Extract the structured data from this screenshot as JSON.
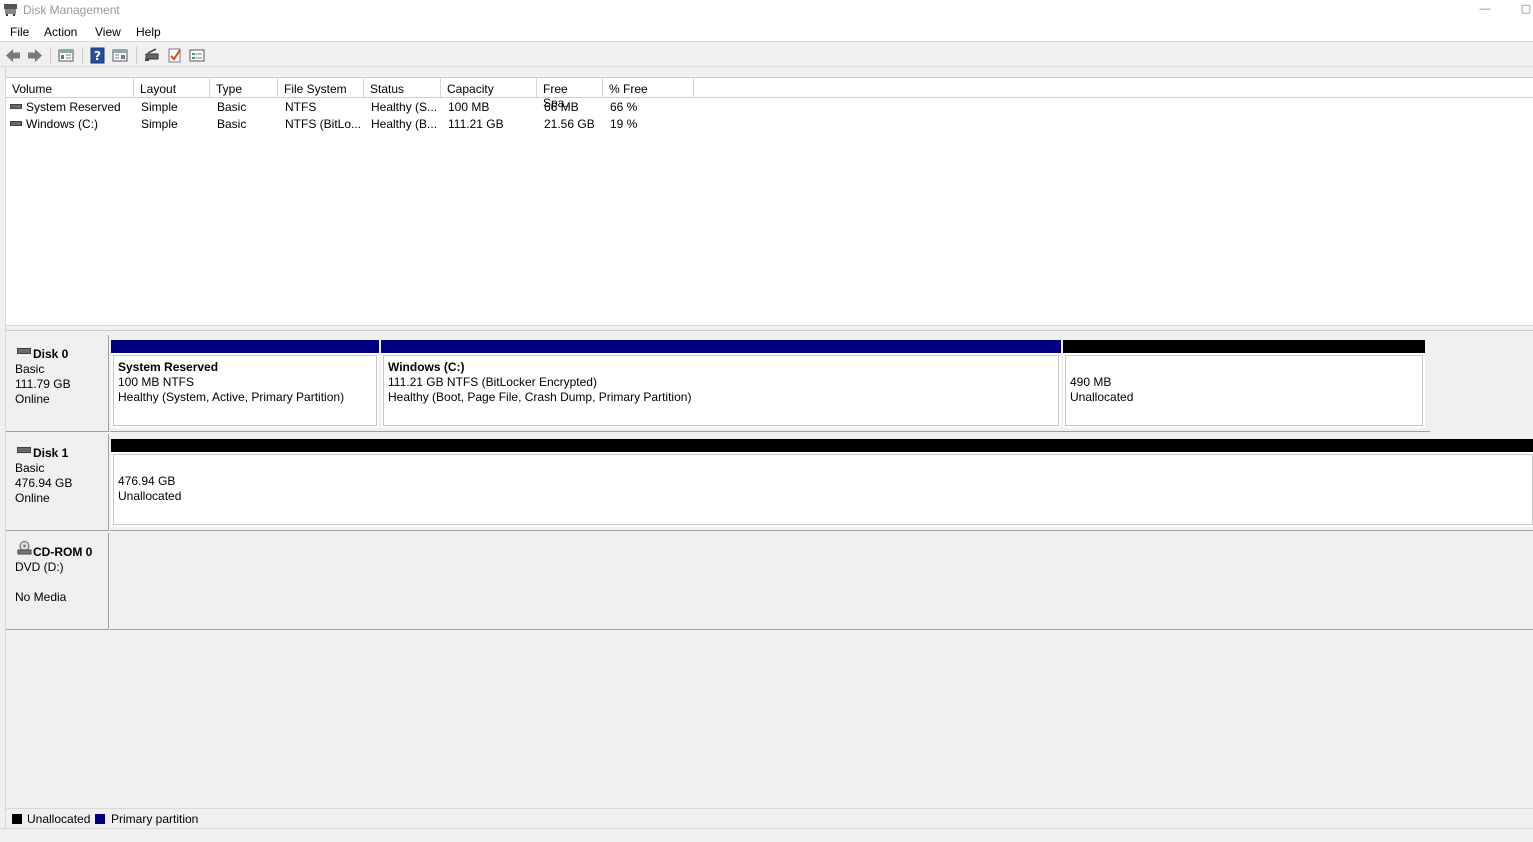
{
  "window": {
    "title": "Disk Management"
  },
  "menu": [
    {
      "label": "File"
    },
    {
      "label": "Action"
    },
    {
      "label": "View"
    },
    {
      "label": "Help"
    }
  ],
  "toolbar": {
    "icons": [
      "back-arrow-icon",
      "forward-arrow-icon",
      "console-tree-icon",
      "help-icon",
      "properties-icon",
      "rescan-disks-icon",
      "check-icon",
      "settings-icon"
    ]
  },
  "volume_list": {
    "columns": [
      "Volume",
      "Layout",
      "Type",
      "File System",
      "Status",
      "Capacity",
      "Free Spa...",
      "% Free"
    ],
    "rows": [
      {
        "volume": "System Reserved",
        "layout": "Simple",
        "type": "Basic",
        "fs": "NTFS",
        "status": "Healthy (S...",
        "capacity": "100 MB",
        "free": "66 MB",
        "pct": "66 %"
      },
      {
        "volume": "Windows (C:)",
        "layout": "Simple",
        "type": "Basic",
        "fs": "NTFS (BitLo...",
        "status": "Healthy (B...",
        "capacity": "111.21 GB",
        "free": "21.56 GB",
        "pct": "19 %"
      }
    ]
  },
  "disks": [
    {
      "name": "Disk 0",
      "type": "Basic",
      "size": "111.79 GB",
      "state": "Online",
      "partitions": [
        {
          "name": "System Reserved",
          "line1": "100 MB NTFS",
          "line2": "Healthy (System, Active, Primary Partition)",
          "kind": "primary"
        },
        {
          "name": "Windows  (C:)",
          "line1": "111.21 GB NTFS (BitLocker Encrypted)",
          "line2": "Healthy (Boot, Page File, Crash Dump, Primary Partition)",
          "kind": "primary"
        },
        {
          "name": "",
          "line1": "490 MB",
          "line2": "Unallocated",
          "kind": "unallocated"
        }
      ]
    },
    {
      "name": "Disk 1",
      "type": "Basic",
      "size": "476.94 GB",
      "state": "Online",
      "partitions": [
        {
          "name": "",
          "line1": "476.94 GB",
          "line2": "Unallocated",
          "kind": "unallocated"
        }
      ]
    },
    {
      "name": "CD-ROM 0",
      "type": "DVD (D:)",
      "size": "",
      "state": "No Media"
    }
  ],
  "legend": [
    {
      "label": "Unallocated",
      "color": "#000000"
    },
    {
      "label": "Primary partition",
      "color": "#000080"
    }
  ],
  "colors": {
    "primary": "#000080",
    "unallocated": "#000000"
  }
}
